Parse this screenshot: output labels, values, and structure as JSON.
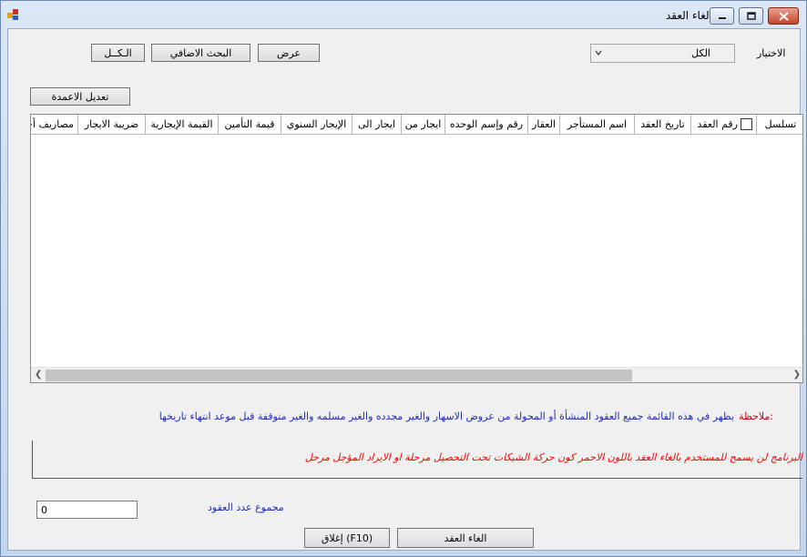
{
  "window": {
    "title": "إلغاء العقد",
    "buttons": {
      "minimize": "minimize-icon",
      "maximize": "maximize-icon",
      "close": "close-icon"
    }
  },
  "filter": {
    "label": "الاختيار",
    "selected": "الكل"
  },
  "toolbar": {
    "view_label": "عرض",
    "advanced_search_label": "البحث الاضافي",
    "all_label": "الـكــل",
    "edit_columns_label": "تعديل الاعمدة"
  },
  "grid": {
    "columns": [
      "تسلسل",
      "رقم العقد",
      "تاريخ العقد",
      "اسم المستأجر",
      "العقار",
      "رقم وإسم الوحده",
      "ايجار من",
      "ايجار الى",
      "الإيجار السنوي",
      "قيمة التأمين",
      "القيمة الإيجارية",
      "ضريبة الايجار",
      "مصاريف أخرى"
    ],
    "rows": []
  },
  "note": {
    "label": "ملاحظة:",
    "text": "يظهر في هذه القائمة جميع العقود المنشأة أو المحولة من عروض الاسهار والغير مجدده والغير مسلمه والغير متوقفة قبل موعد انتهاء تاريخها",
    "warning": "البرنامج لن يسمح للمستخدم بالغاء العقد باللون الاحمر كون حركة الشيكات تحت التحصيل مرحلة او الايراد المؤجل مرحل"
  },
  "summary": {
    "count_label": "مجموع عدد العقود",
    "count_value": "0"
  },
  "footer": {
    "cancel_contract_label": "الغاء العقد",
    "close_label": "إغلاق (F10)"
  },
  "colors": {
    "note_label": "#c00000",
    "note_text": "#1f2fb0",
    "warning_text": "#ff0000"
  }
}
